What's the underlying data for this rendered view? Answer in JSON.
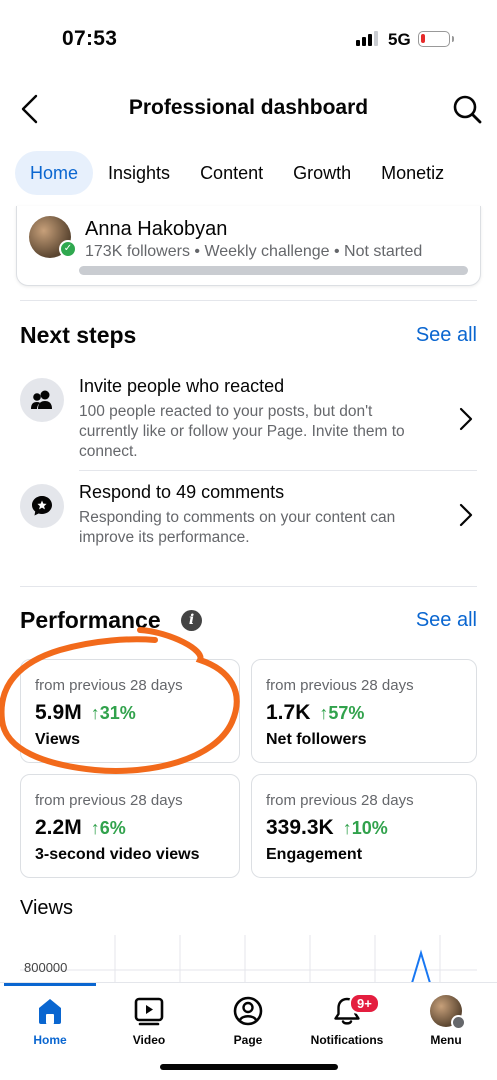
{
  "status_bar": {
    "time": "07:53",
    "network": "5G",
    "battery_color": "#e62b2b"
  },
  "header": {
    "title": "Professional dashboard",
    "back_icon": "chevron-left-icon",
    "search_icon": "search-icon"
  },
  "tabs": [
    {
      "label": "Home",
      "active": true
    },
    {
      "label": "Insights"
    },
    {
      "label": "Content"
    },
    {
      "label": "Growth"
    },
    {
      "label": "Monetiz"
    }
  ],
  "profile": {
    "name": "Anna Hakobyan",
    "meta": "173K followers • Weekly challenge • Not started",
    "challenge_progress": 0
  },
  "next_steps": {
    "title": "Next steps",
    "see_all": "See all",
    "items": [
      {
        "icon": "people-icon",
        "title": "Invite people who reacted",
        "description": "100 people reacted to your posts, but don't currently like or follow your Page. Invite them to connect."
      },
      {
        "icon": "comment-star-icon",
        "title": "Respond to 49 comments",
        "description": "Responding to comments on your content can improve its performance."
      }
    ]
  },
  "performance": {
    "title": "Performance",
    "see_all": "See all",
    "metrics": [
      {
        "period": "from previous 28 days",
        "value": "5.9M",
        "change": "↑31%",
        "label": "Views"
      },
      {
        "period": "from previous 28 days",
        "value": "1.7K",
        "change": "↑57%",
        "label": "Net followers"
      },
      {
        "period": "from previous 28 days",
        "value": "2.2M",
        "change": "↑6%",
        "label": "3-second video views"
      },
      {
        "period": "from previous 28 days",
        "value": "339.3K",
        "change": "↑10%",
        "label": "Engagement"
      }
    ]
  },
  "views_chart": {
    "title": "Views",
    "ytick": "800000"
  },
  "bottom_nav": {
    "items": [
      {
        "label": "Home",
        "icon": "home-icon",
        "active": true
      },
      {
        "label": "Video",
        "icon": "video-icon"
      },
      {
        "label": "Page",
        "icon": "page-icon"
      },
      {
        "label": "Notifications",
        "icon": "bell-icon",
        "badge": "9+"
      },
      {
        "label": "Menu",
        "icon": "menu-avatar-icon"
      }
    ]
  },
  "colors": {
    "accent": "#0a66d0",
    "positive": "#31a24c",
    "annotation": "#f26a1b",
    "badge": "#e41e3f"
  }
}
